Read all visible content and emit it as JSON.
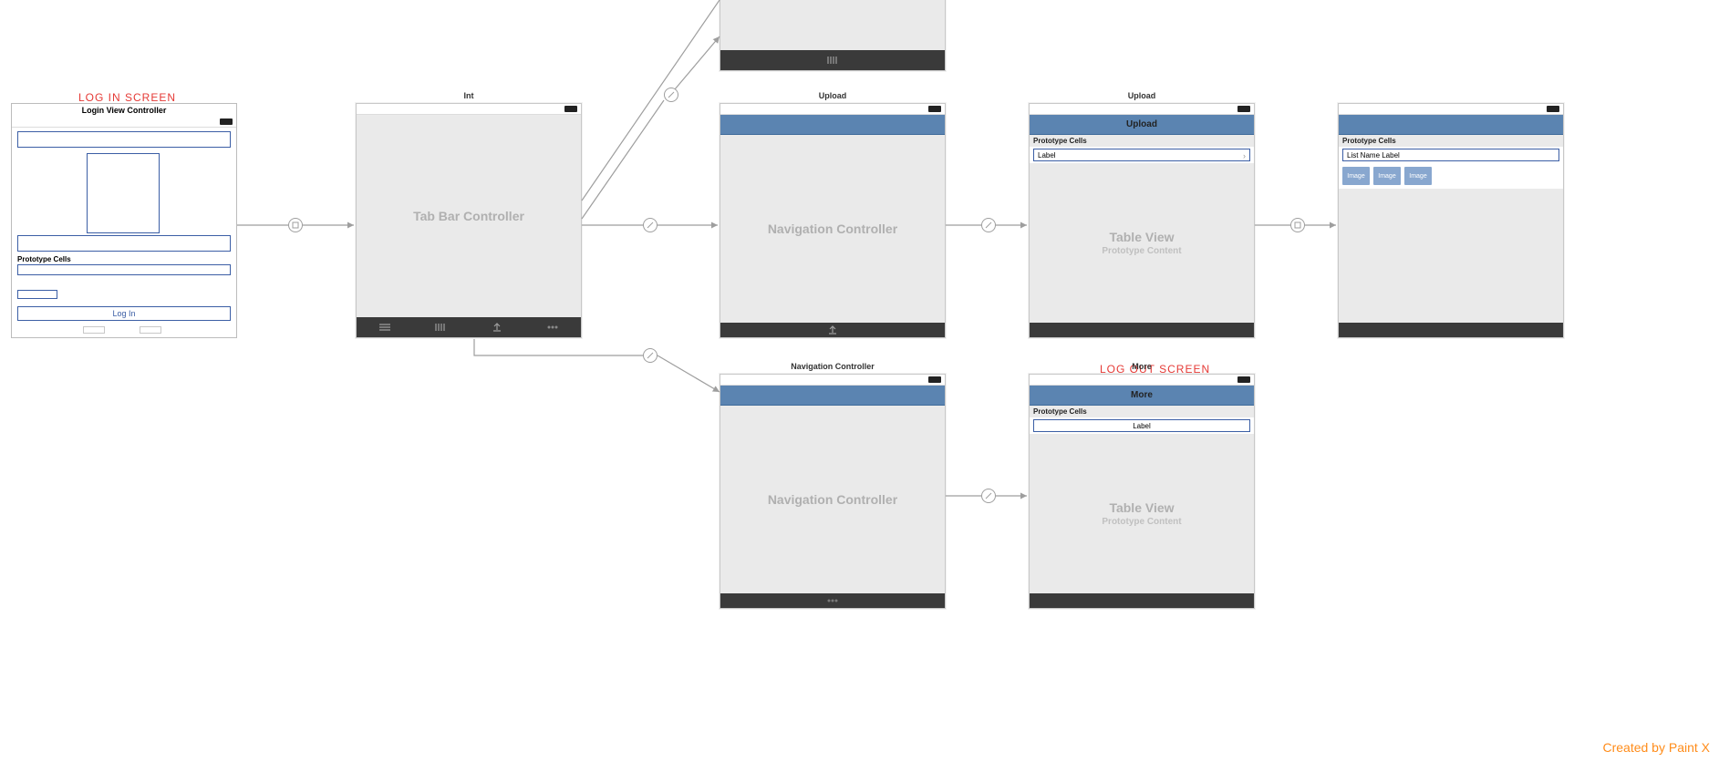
{
  "annotations": {
    "login_screen": "LOG IN SCREEN",
    "logout_screen": "LOG OUT SCREEN"
  },
  "watermark": "Created by Paint X",
  "scenes": {
    "login": {
      "title": "Login View Controller",
      "prototype_cells": "Prototype Cells",
      "login_button": "Log In"
    },
    "tabbar": {
      "title": "Int",
      "body_label": "Tab Bar Controller",
      "tabs": [
        "My List",
        "Scanner",
        "Upload",
        "More"
      ]
    },
    "top_partial": {
      "tab_label": "Scanner"
    },
    "nav_upload": {
      "title": "Upload",
      "body_label": "Navigation Controller"
    },
    "tableview_upload": {
      "title": "Upload",
      "nav_title": "Upload",
      "prototype_cells": "Prototype Cells",
      "cell_label": "Label",
      "body_label": "Table View",
      "body_sub": "Prototype Content"
    },
    "list_scene": {
      "prototype_cells": "Prototype Cells",
      "cell_label": "List Name Label",
      "chip_label": "Image"
    },
    "nav_more": {
      "title": "Navigation Controller",
      "body_label": "Navigation Controller"
    },
    "tableview_more": {
      "title": "More",
      "nav_title": "More",
      "prototype_cells": "Prototype Cells",
      "cell_label": "Label",
      "body_label": "Table View",
      "body_sub": "Prototype Content"
    }
  }
}
